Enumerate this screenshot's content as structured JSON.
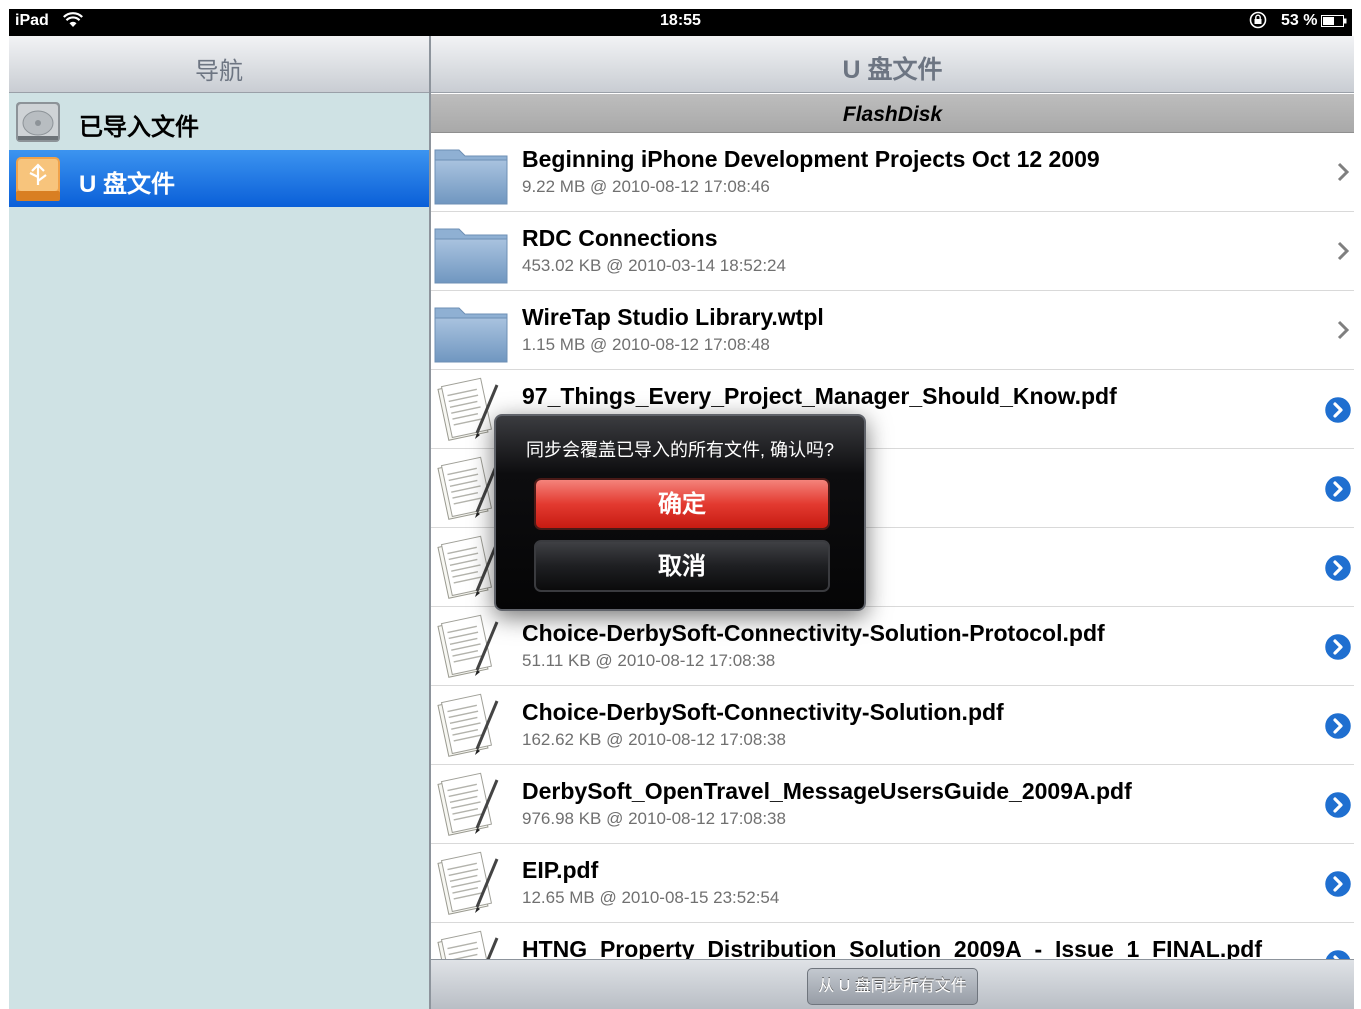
{
  "status_bar": {
    "device": "iPad",
    "time": "18:55",
    "battery_percent": "53 %"
  },
  "sidebar": {
    "title": "导航",
    "items": [
      {
        "label": "已导入文件",
        "icon": "hard-drive-icon",
        "selected": false
      },
      {
        "label": "U 盘文件",
        "icon": "usb-drive-icon",
        "selected": true
      }
    ]
  },
  "main": {
    "title": "U 盘文件",
    "section": "FlashDisk",
    "files": [
      {
        "name": "Beginning iPhone Development Projects Oct 12 2009",
        "meta": "9.22 MB @ 2010-08-12 17:08:46",
        "type": "folder"
      },
      {
        "name": "RDC Connections",
        "meta": "453.02 KB @ 2010-03-14 18:52:24",
        "type": "folder"
      },
      {
        "name": "WireTap Studio Library.wtpl",
        "meta": "1.15 MB @ 2010-08-12 17:08:48",
        "type": "folder"
      },
      {
        "name": "97_Things_Every_Project_Manager_Should_Know.pdf",
        "meta": "",
        "type": "pdf"
      },
      {
        "name": "",
        "meta": "",
        "type": "pdf"
      },
      {
        "name": "",
        "meta": "",
        "type": "pdf"
      },
      {
        "name": "Choice-DerbySoft-Connectivity-Solution-Protocol.pdf",
        "meta": "51.11 KB @ 2010-08-12 17:08:38",
        "type": "pdf"
      },
      {
        "name": "Choice-DerbySoft-Connectivity-Solution.pdf",
        "meta": "162.62 KB @ 2010-08-12 17:08:38",
        "type": "pdf"
      },
      {
        "name": "DerbySoft_OpenTravel_MessageUsersGuide_2009A.pdf",
        "meta": "976.98 KB @ 2010-08-12 17:08:38",
        "type": "pdf"
      },
      {
        "name": "EIP.pdf",
        "meta": "12.65 MB @ 2010-08-15 23:52:54",
        "type": "pdf"
      },
      {
        "name": "HTNG_Property_Distribution_Solution_2009A_-_Issue_1_FINAL.pdf",
        "meta": "",
        "type": "pdf"
      }
    ],
    "sync_button": "从 U 盘同步所有文件"
  },
  "alert": {
    "message": "同步会覆盖已导入的所有文件, 确认吗?",
    "confirm_label": "确定",
    "cancel_label": "取消"
  },
  "colors": {
    "selection": "#0a5fd8",
    "sidebar_bg": "#cfe2e4",
    "disclosure": "#1f6fd0",
    "confirm": "#e33a30"
  }
}
